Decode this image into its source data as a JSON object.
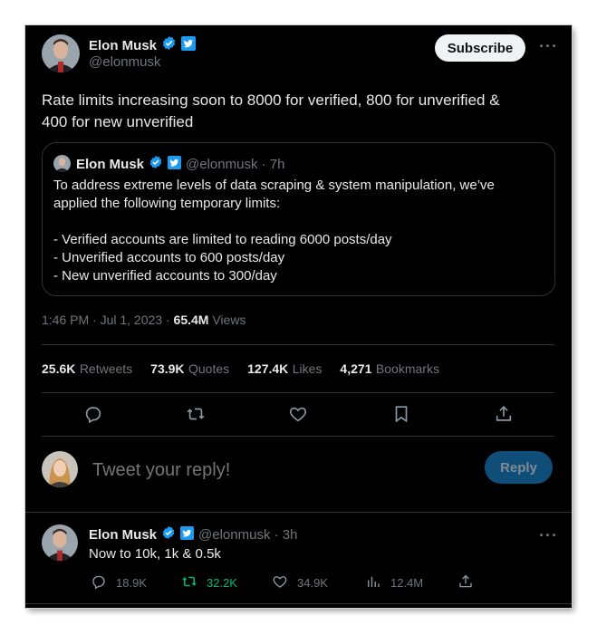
{
  "main_tweet": {
    "author_name": "Elon Musk",
    "handle": "@elonmusk",
    "subscribe_label": "Subscribe",
    "more_label": "···",
    "text_line1": "Rate limits increasing soon to 8000 for verified, 800 for unverified &",
    "text_line2": "400 for new unverified",
    "timestamp": "1:46 PM · Jul 1, 2023 · ",
    "views_count": "65.4M",
    "views_label": "Views"
  },
  "quoted_tweet": {
    "author_name": "Elon Musk",
    "handle_time": "@elonmusk · 7h",
    "line1": "To address extreme levels of data scraping & system manipulation, we’ve",
    "line2": "applied the following temporary limits:",
    "line3": "- Verified accounts are limited to reading 6000 posts/day",
    "line4": "- Unverified accounts to 600 posts/day",
    "line5": "- New unverified accounts to 300/day"
  },
  "stats": [
    {
      "num": "25.6K",
      "label": "Retweets"
    },
    {
      "num": "73.9K",
      "label": "Quotes"
    },
    {
      "num": "127.4K",
      "label": "Likes"
    },
    {
      "num": "4,271",
      "label": "Bookmarks"
    }
  ],
  "actions": [
    "reply-icon",
    "retweet-icon",
    "like-icon",
    "bookmark-icon",
    "share-icon"
  ],
  "reply_box": {
    "placeholder": "Tweet your reply!",
    "button_label": "Reply"
  },
  "reply_tweet": {
    "author_name": "Elon Musk",
    "handle_time": "@elonmusk · 3h",
    "more_label": "···",
    "text": "Now to 10k, 1k & 0.5k",
    "replies": "18.9K",
    "retweets": "32.2K",
    "likes": "34.9K",
    "views": "12.4M"
  },
  "colors": {
    "background": "#000000",
    "verified_blue": "#1d9bf0",
    "retweet_green": "#00ba7c",
    "muted": "#71767b",
    "reply_button": "#0f4e78"
  }
}
